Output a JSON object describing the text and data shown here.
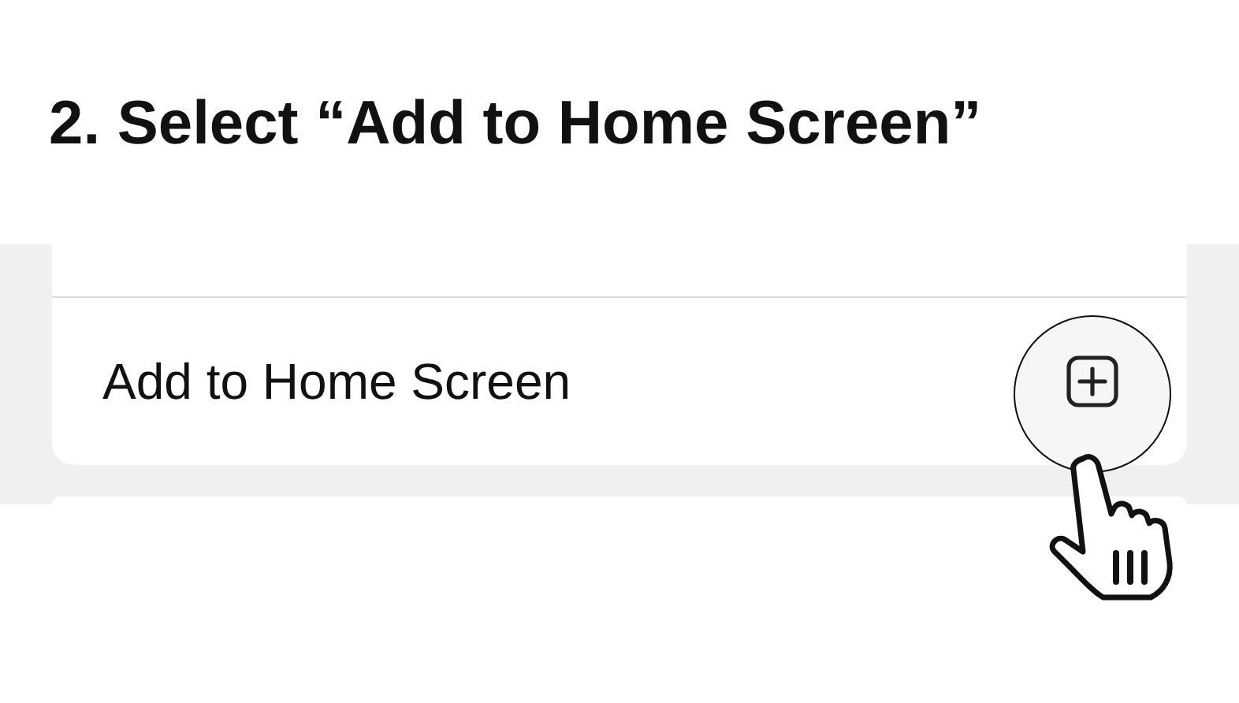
{
  "step_title": "2. Select “Add to Home Screen”",
  "menu": {
    "items": [
      {
        "label": "Add to Home Screen",
        "highlighted": true
      }
    ]
  }
}
